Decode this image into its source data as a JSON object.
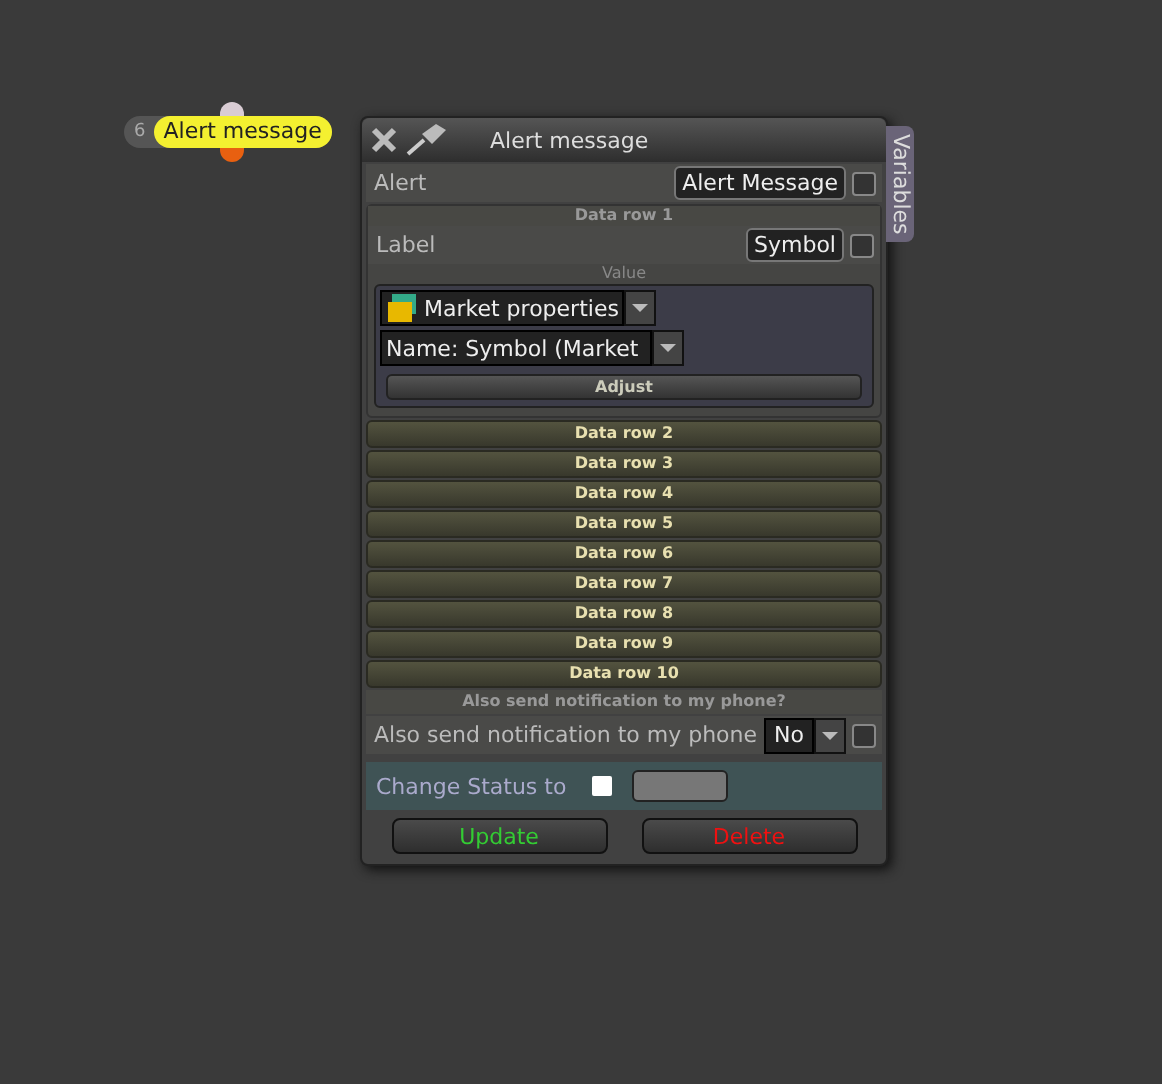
{
  "node": {
    "count": "6",
    "label": "Alert message"
  },
  "window": {
    "title": "Alert message",
    "side_tab": "Variables"
  },
  "alert": {
    "label": "Alert",
    "value": "Alert Message",
    "checked": false
  },
  "data_rows": [
    {
      "title": "Data row 1",
      "expanded": true,
      "label": "Label",
      "value": "Symbol",
      "checked": false,
      "value_caption": "Value",
      "source": "Market properties",
      "field": "Name: Symbol (Market",
      "adjust": "Adjust"
    },
    {
      "title": "Data row 2",
      "expanded": false
    },
    {
      "title": "Data row 3",
      "expanded": false
    },
    {
      "title": "Data row 4",
      "expanded": false
    },
    {
      "title": "Data row 5",
      "expanded": false
    },
    {
      "title": "Data row 6",
      "expanded": false
    },
    {
      "title": "Data row 7",
      "expanded": false
    },
    {
      "title": "Data row 8",
      "expanded": false
    },
    {
      "title": "Data row 9",
      "expanded": false
    },
    {
      "title": "Data row 10",
      "expanded": false
    }
  ],
  "notification": {
    "title": "Also send notification to my phone?",
    "label": "Also send notification to my phone",
    "value": "No",
    "checked": false
  },
  "status": {
    "label": "Change Status to",
    "checked": false
  },
  "buttons": [
    {
      "label": "Update",
      "kind": "update"
    },
    {
      "label": "Delete",
      "kind": "delete"
    }
  ]
}
